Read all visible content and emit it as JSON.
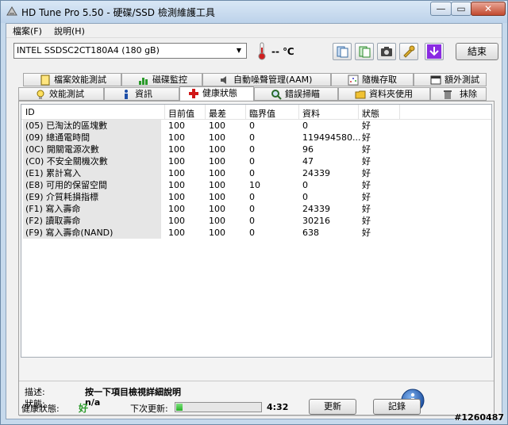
{
  "window": {
    "title": "HD Tune Pro 5.50 - 硬碟/SSD 檢測維護工具",
    "min_glyph": "—",
    "max_glyph": "▭",
    "close_glyph": "✕"
  },
  "menu": [
    "檔案(F)",
    "說明(H)"
  ],
  "toolbar": {
    "drive": "INTEL SSDSC2CT180A4 (180 gB)",
    "temperature": "-- ℃",
    "exit_label": "結束"
  },
  "tabs_top": [
    "檔案效能測試",
    "磁碟監控",
    "自動噪聲管理(AAM)",
    "隨機存取",
    "額外測試"
  ],
  "tabs_bottom": [
    "效能測試",
    "資訊",
    "健康狀態",
    "錯誤掃瞄",
    "資料夾使用",
    "抹除"
  ],
  "active_tab": "健康狀態",
  "table": {
    "headers": [
      "ID",
      "目前值",
      "最差",
      "臨界值",
      "資料",
      "狀態"
    ],
    "rows": [
      [
        "(05) 已淘汰的區塊數",
        "100",
        "100",
        "0",
        "0",
        "好"
      ],
      [
        "(09) 總通電時間",
        "100",
        "100",
        "0",
        "119494580...",
        "好"
      ],
      [
        "(0C) 開關電源次數",
        "100",
        "100",
        "0",
        "96",
        "好"
      ],
      [
        "(C0) 不安全關機次數",
        "100",
        "100",
        "0",
        "47",
        "好"
      ],
      [
        "(E1) 累計寫入",
        "100",
        "100",
        "0",
        "24339",
        "好"
      ],
      [
        "(E8) 可用的保留空間",
        "100",
        "100",
        "10",
        "0",
        "好"
      ],
      [
        "(E9) 介質耗損指標",
        "100",
        "100",
        "0",
        "0",
        "好"
      ],
      [
        "(F1) 寫入壽命",
        "100",
        "100",
        "0",
        "24339",
        "好"
      ],
      [
        "(F2) 讀取壽命",
        "100",
        "100",
        "0",
        "30216",
        "好"
      ],
      [
        "(F9) 寫入壽命(NAND)",
        "100",
        "100",
        "0",
        "638",
        "好"
      ]
    ]
  },
  "details": {
    "desc_label": "描述:",
    "desc_value": "按一下項目檢視詳細說明",
    "status_label": "狀態:",
    "status_value": "n/a"
  },
  "footer": {
    "health_label": "健康狀態:",
    "health_value": "好",
    "next_update_label": "下次更新:",
    "progress_fraction": 0.08,
    "countdown": "4:32",
    "refresh_label": "更新",
    "log_label": "記錄"
  },
  "watermark": "#1260487",
  "colors": {
    "good": "#2c9a2c",
    "progress": "#27b027",
    "title_bar": "#c6d9ec"
  }
}
